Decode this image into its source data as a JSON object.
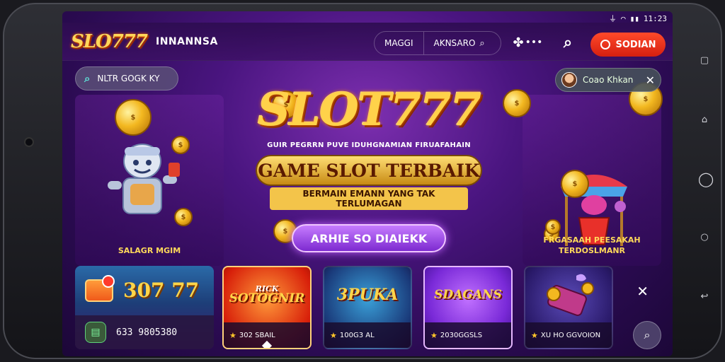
{
  "status_bar": {
    "time": "11:23",
    "signal_icon": "signal-icon",
    "wifi_icon": "wifi-icon"
  },
  "header": {
    "logo_text": "SLO777",
    "brand_name": "INNANNSA",
    "nav": {
      "item1": "MAGGI",
      "item2": "AKNSARO"
    },
    "signup_label": "SODIAN"
  },
  "hero": {
    "search_chip_label": "NLTR GOGK KY",
    "promo_chip_label": "Coao Khkan",
    "title": "SLOT777",
    "tagline": "GUIR PEGRRN PUVE IDUHGNAMIAN FIRUAFAHAIN",
    "ribbon_title": "GAME SLOT TERBAIK",
    "ribbon_subtitle": "BERMAIN EMANN YANG TAK TERLUMAGAN",
    "cta_label": "ARHIE SO DIAIEKK",
    "left_caption": "SALAGR MGIM",
    "right_caption_line1": "FRGASAAH PEESAKAH",
    "right_caption_line2": "TERDOSLMANR"
  },
  "strip": {
    "wallet_amount": "307 77",
    "balance_text": "633 9805380",
    "games": [
      {
        "art_text": "SOTOGNIR",
        "art_small": "RICK",
        "foot": "302 SBAIL"
      },
      {
        "art_text": "3PUKA",
        "art_small": "",
        "foot": "100G3 AL"
      },
      {
        "art_text": "SDAGANS",
        "art_small": "",
        "foot": "2030GGSLS"
      },
      {
        "art_text": "",
        "art_small": "",
        "foot": "XU HO GGVOION"
      }
    ]
  },
  "colors": {
    "accent": "#ffd24a",
    "signup": "#e9281a",
    "bg": "#4a1580"
  }
}
